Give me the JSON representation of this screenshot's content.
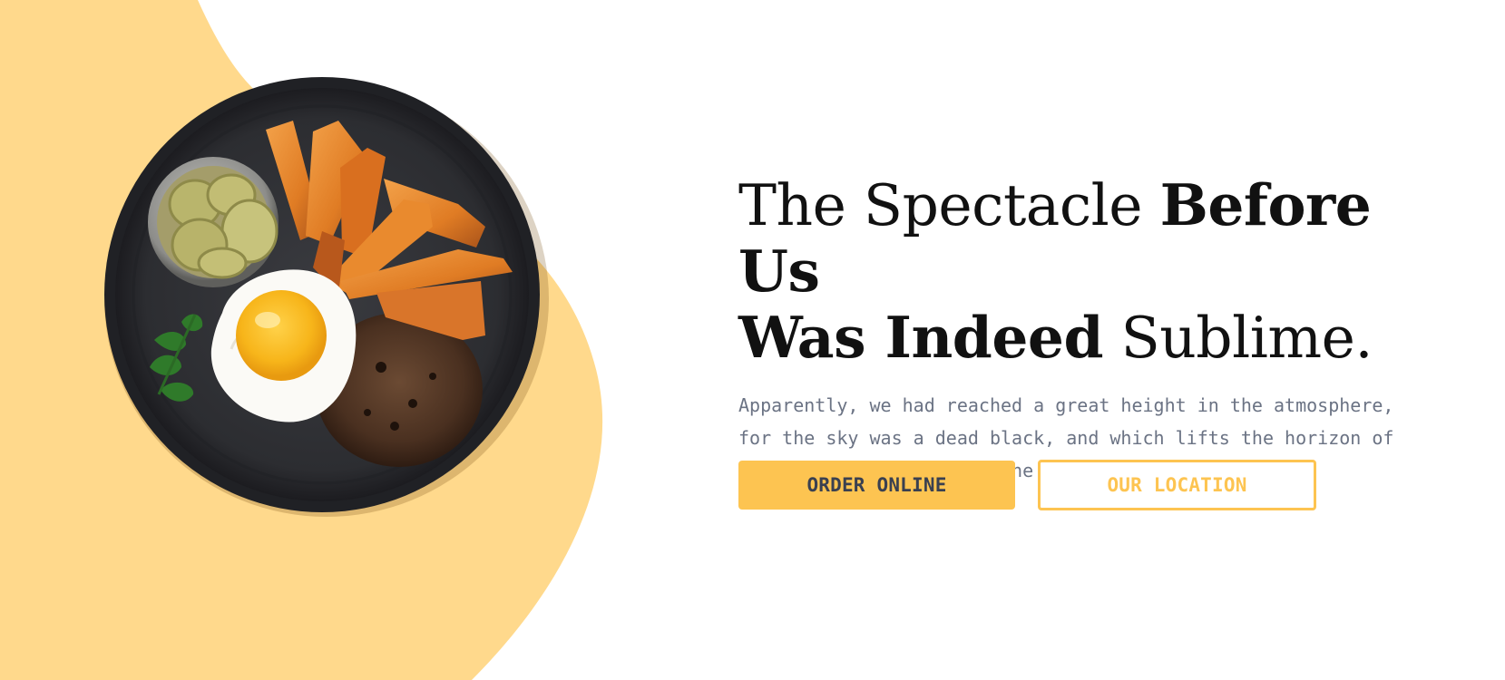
{
  "hero": {
    "headline_light_1": "The Spectacle ",
    "headline_bold_1": "Before Us",
    "headline_bold_2": "Was Indeed",
    "headline_light_2": " Sublime.",
    "description": "Apparently, we had reached a great height in the atmosphere, for the sky was a dead black, and which lifts the horizon of the sea to the level of the spectator on a hillside."
  },
  "buttons": {
    "order_label": "ORDER ONLINE",
    "location_label": "OUR LOCATION"
  },
  "colors": {
    "accent": "#fdc451",
    "blob": "#ffd98c",
    "text_dark": "#111111",
    "text_muted": "#6b7384"
  },
  "image": {
    "subject": "plate-of-food",
    "contents": [
      "sweet-potato-fries",
      "fried-egg",
      "burger-patty",
      "pickles-cup",
      "parsley"
    ]
  }
}
